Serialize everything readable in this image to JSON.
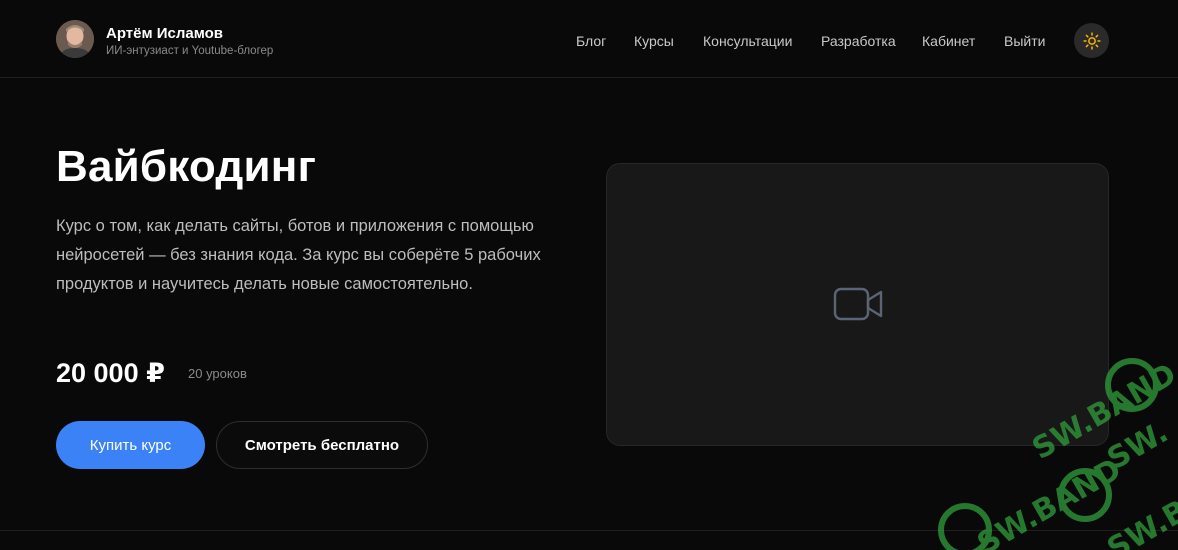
{
  "header": {
    "name": "Артём Исламов",
    "tagline": "ИИ-энтузиаст и Youtube-блогер",
    "avatar_icon": "user-avatar-photo"
  },
  "nav": {
    "items": [
      {
        "label": "Блог"
      },
      {
        "label": "Курсы"
      },
      {
        "label": "Консультации"
      },
      {
        "label": "Разработка"
      },
      {
        "label": "Кабинет"
      },
      {
        "label": "Выйти"
      }
    ],
    "theme_icon": "sun-icon"
  },
  "hero": {
    "title": "Вайбкодинг",
    "description": "Курс о том, как делать сайты, ботов и приложения с помощью нейросетей — без знания кода. За курс вы соберёте 5 рабочих продуктов и научитесь делать новые самостоятельно.",
    "price": "20 000 ₽",
    "lessons": "20 уроков",
    "buy_label": "Купить курс",
    "watch_label": "Смотреть бесплатно"
  },
  "video": {
    "icon": "video-camera-icon"
  },
  "watermark": {
    "text": "SW.BAND"
  },
  "colors": {
    "background": "#090909",
    "accent": "#3b82f6",
    "sun": "#f5b400",
    "watermark": "#2f9e3a"
  }
}
